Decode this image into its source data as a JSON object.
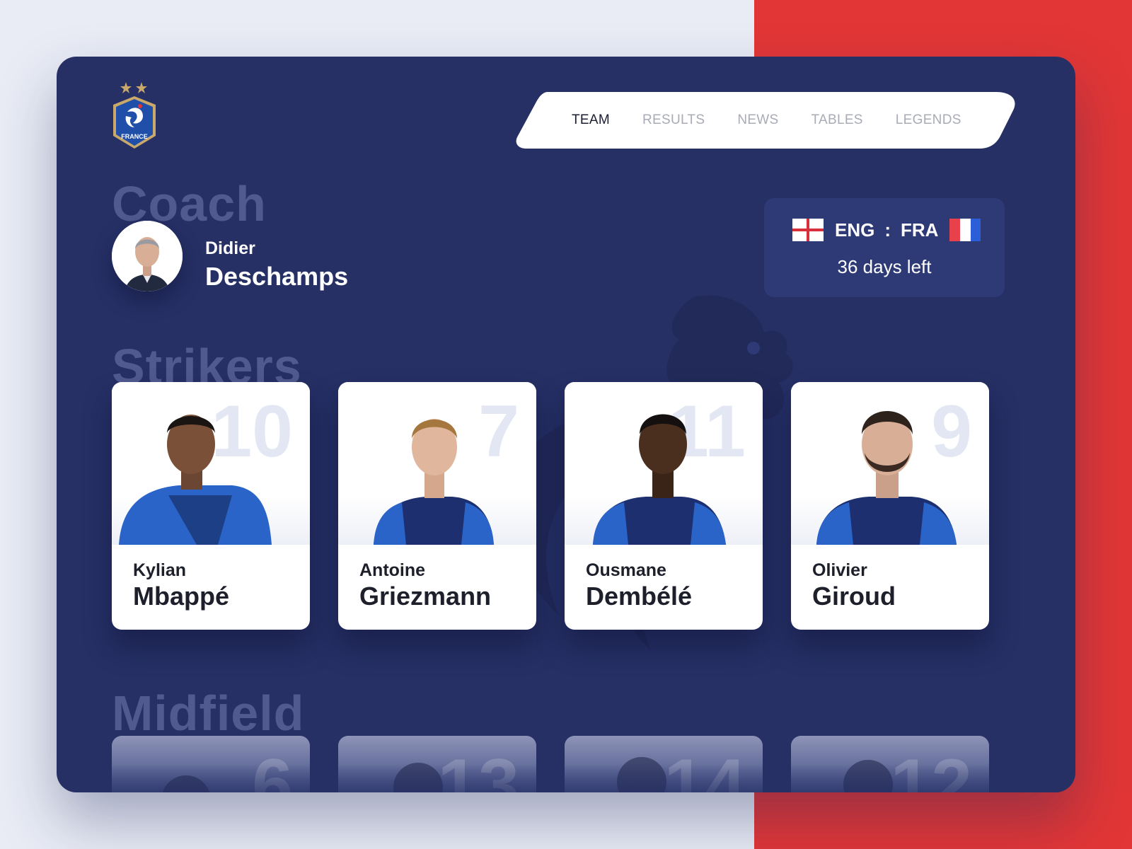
{
  "colors": {
    "panel": "#263065",
    "page_background": "#e9ecf5",
    "accent_red": "#e23636",
    "white": "#ffffff",
    "flag_blue": "#2b5fd8",
    "flag_red": "#e8414b"
  },
  "header": {
    "logo": {
      "icon": "fff-crest-icon",
      "stars": 2,
      "text": "FRANCE"
    }
  },
  "nav": {
    "items": [
      {
        "label": "TEAM",
        "active": true
      },
      {
        "label": "RESULTS",
        "active": false
      },
      {
        "label": "NEWS",
        "active": false
      },
      {
        "label": "TABLES",
        "active": false
      },
      {
        "label": "LEGENDS",
        "active": false
      }
    ]
  },
  "coach": {
    "section_label": "Coach",
    "first_name": "Didier",
    "last_name": "Deschamps"
  },
  "match": {
    "home": "ENG",
    "separator": ":",
    "away": "FRA",
    "home_flag_icon": "england-flag-icon",
    "away_flag_icon": "france-flag-icon",
    "countdown": "36 days left"
  },
  "strikers": {
    "section_label": "Strikers",
    "players": [
      {
        "first_name": "Kylian",
        "last_name": "Mbappé",
        "number": "10"
      },
      {
        "first_name": "Antoine",
        "last_name": "Griezmann",
        "number": "7"
      },
      {
        "first_name": "Ousmane",
        "last_name": "Dembélé",
        "number": "11"
      },
      {
        "first_name": "Olivier",
        "last_name": "Giroud",
        "number": "9"
      }
    ]
  },
  "midfield": {
    "section_label": "Midfield",
    "players": [
      {
        "number": "6"
      },
      {
        "number": "13"
      },
      {
        "number": "14"
      },
      {
        "number": "12"
      }
    ]
  }
}
